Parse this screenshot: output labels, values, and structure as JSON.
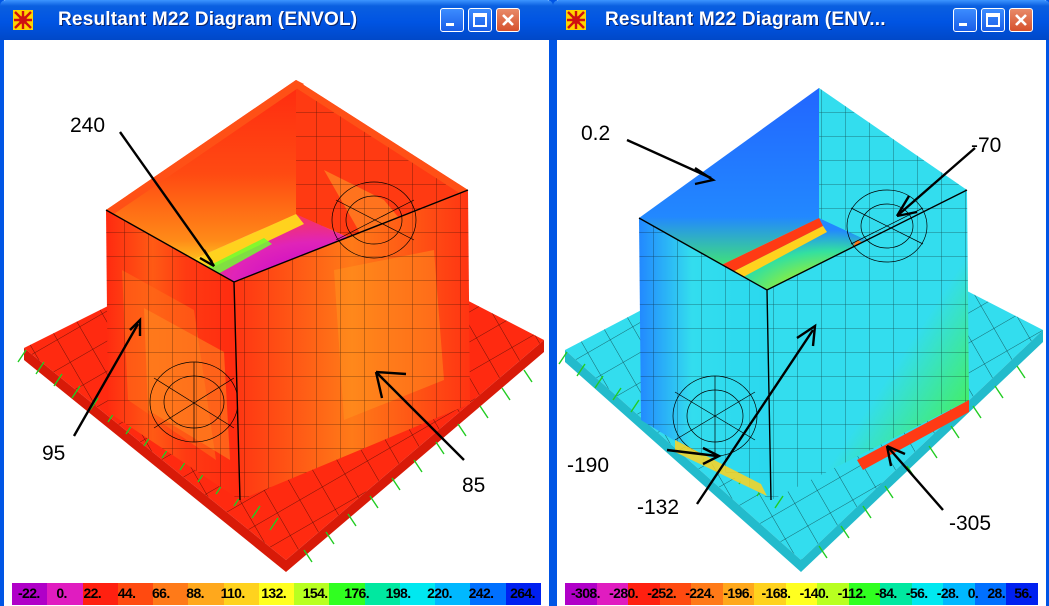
{
  "colors": {
    "titlebar": "#0054e3",
    "window_border": "#0055e5",
    "left_base": "#ff2a10",
    "left_warm": "#ff7a18",
    "left_hot": "#ffd21e",
    "left_purple": "#c800cc",
    "right_base": "#33ddee",
    "right_blue": "#1177ff",
    "right_green": "#44ee66",
    "right_yellow": "#ffff22",
    "mesh": "#000000"
  },
  "windows": [
    {
      "title": "Resultant M22 Diagram   (ENVOL)",
      "annotations": {
        "a1": "240",
        "a2": "95",
        "a3": "85"
      },
      "legend_colors": [
        "#b000c8",
        "#e01cc0",
        "#ff2010",
        "#ff4a10",
        "#ff7a18",
        "#ffa81c",
        "#ffd21e",
        "#ffff20",
        "#b8ff20",
        "#30ff20",
        "#00e8a0",
        "#00e8f0",
        "#00b8ff",
        "#0070ff",
        "#0020f0"
      ],
      "legend_labels": [
        "-22.",
        "0.",
        "22.",
        "44.",
        "66.",
        "88.",
        "110.",
        "132.",
        "154.",
        "176.",
        "198.",
        "220.",
        "242.",
        "264."
      ]
    },
    {
      "title": "Resultant M22 Diagram   (ENV...",
      "annotations": {
        "a1": "0.2",
        "a2": "-70",
        "a3": "-190",
        "a4": "-132",
        "a5": "-305"
      },
      "legend_colors": [
        "#b000c8",
        "#e01cc0",
        "#ff2010",
        "#ff4a10",
        "#ff7a18",
        "#ffa81c",
        "#ffd21e",
        "#ffff20",
        "#b8ff20",
        "#30ff20",
        "#00e8a0",
        "#00e8f0",
        "#00b8ff",
        "#0070ff",
        "#0020f0"
      ],
      "legend_labels": [
        "-308.",
        "-280.",
        "-252.",
        "-224.",
        "-196.",
        "-168.",
        "-140.",
        "-112.",
        "-84.",
        "-56.",
        "-28.",
        "0.",
        "28.",
        "56."
      ]
    }
  ]
}
